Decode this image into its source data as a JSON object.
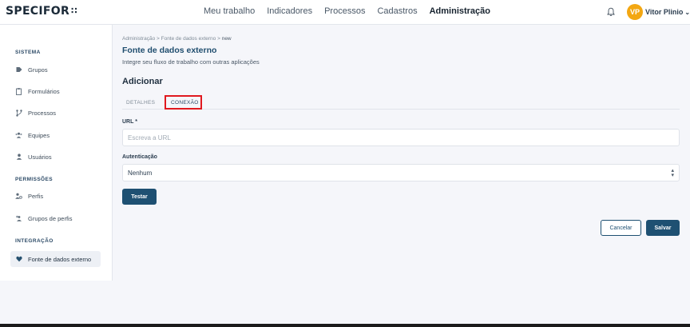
{
  "header": {
    "logo": "SPECIFOR",
    "logo_mark": "∷",
    "nav": [
      "Meu trabalho",
      "Indicadores",
      "Processos",
      "Cadastros",
      "Administração"
    ],
    "active_nav": "Administração",
    "avatar_initials": "VP",
    "avatar_color": "#f3a712",
    "user_name": "Vitor Plinio"
  },
  "sidebar": {
    "sections": [
      {
        "title": "SISTEMA",
        "items": [
          {
            "label": "Grupos",
            "icon": "tag-icon"
          },
          {
            "label": "Formulários",
            "icon": "form-icon"
          },
          {
            "label": "Processos",
            "icon": "process-icon"
          },
          {
            "label": "Equipes",
            "icon": "team-icon"
          },
          {
            "label": "Usuários",
            "icon": "user-icon"
          }
        ]
      },
      {
        "title": "PERMISSÕES",
        "items": [
          {
            "label": "Perfis",
            "icon": "profile-icon"
          },
          {
            "label": "Grupos de perfis",
            "icon": "profile-group-icon"
          }
        ]
      },
      {
        "title": "INTEGRAÇÃO",
        "items": [
          {
            "label": "Fonte de dados externo",
            "icon": "heart-icon",
            "active": true
          }
        ]
      }
    ]
  },
  "breadcrumb": {
    "items": [
      "Administração",
      "Fonte de dados externo",
      "new"
    ],
    "separator": ">"
  },
  "page": {
    "title": "Fonte de dados externo",
    "subtitle": "Integre seu fluxo de trabalho com outras aplicações",
    "section": "Adicionar"
  },
  "tabs": {
    "detalhes": "DETALHES",
    "conexao": "CONEXÃO",
    "active": "CONEXÃO"
  },
  "form": {
    "url_label": "URL",
    "url_required_mark": "*",
    "url_placeholder": "Escreva a URL",
    "auth_label": "Autenticação",
    "auth_value": "Nenhum",
    "test_button": "Testar"
  },
  "actions": {
    "cancel": "Cancelar",
    "save": "Salvar"
  },
  "colors": {
    "primary": "#1e5072",
    "highlight": "#e0191f",
    "title": "#1f4d6e"
  }
}
